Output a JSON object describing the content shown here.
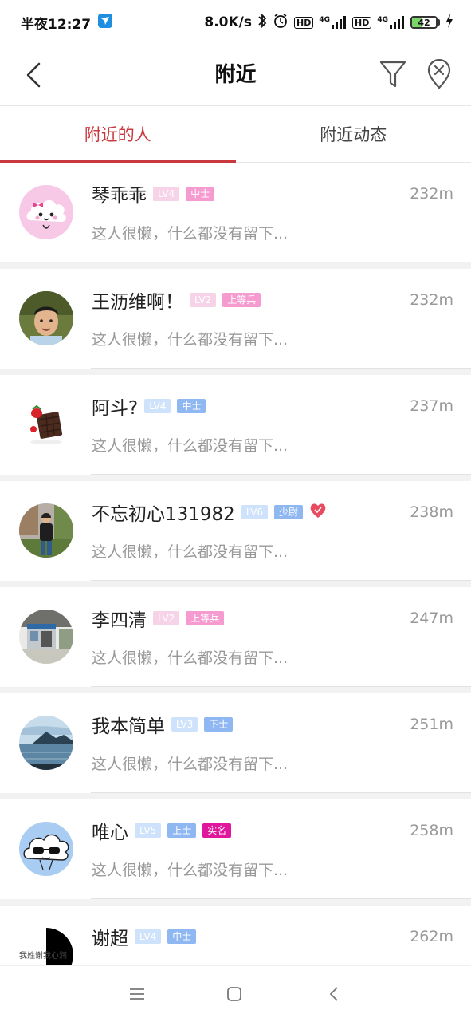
{
  "status_bar": {
    "time": "半夜12:27",
    "net_speed": "8.0K/s",
    "hd1": "HD",
    "hd2": "HD",
    "net1": "4G",
    "net2": "4G",
    "battery": "42",
    "battery_level": 0.42,
    "icons": [
      "app-notification-icon",
      "bluetooth-icon",
      "alarm-icon",
      "signal-icon",
      "battery-icon",
      "charging-icon"
    ]
  },
  "header": {
    "title": "附近",
    "icons": [
      "back-icon",
      "filter-icon",
      "location-clear-icon"
    ]
  },
  "tabs": [
    {
      "label": "附近的人",
      "active": true
    },
    {
      "label": "附近动态",
      "active": false
    }
  ],
  "colors": {
    "accent": "#c9383f",
    "lv_pink_bg": "#f7d3e8",
    "lv_pink_fg": "#ffffff",
    "rank_pink_bg": "#f59bd0",
    "lv_blue_bg": "#cfe2fb",
    "rank_blue_bg": "#8fb8f2",
    "verified_bg": "#e0169c"
  },
  "users": [
    {
      "name": "琴乖乖",
      "level": "LV4",
      "rank": "中士",
      "theme": "pink",
      "distance": "232m",
      "signature": "这人很懒，什么都没有留下...",
      "avatar": "cloud-cartoon-pink"
    },
    {
      "name": "王沥维啊！",
      "level": "LV2",
      "rank": "上等兵",
      "theme": "pink",
      "distance": "232m",
      "signature": "这人很懒，什么都没有留下...",
      "avatar": "child-photo"
    },
    {
      "name": "阿斗?",
      "level": "LV4",
      "rank": "中士",
      "theme": "blue",
      "distance": "237m",
      "signature": "这人很懒，什么都没有留下...",
      "avatar": "chocolate-photo"
    },
    {
      "name": "不忘初心131982",
      "level": "LV6",
      "rank": "少尉",
      "theme": "blue",
      "distance": "238m",
      "signature": "这人很懒，什么都没有留下...",
      "avatar": "man-outdoor-photo",
      "heart": true
    },
    {
      "name": "李四清",
      "level": "LV2",
      "rank": "上等兵",
      "theme": "pink",
      "distance": "247m",
      "signature": "这人很懒，什么都没有留下...",
      "avatar": "kiosk-photo"
    },
    {
      "name": "我本简单",
      "level": "LV3",
      "rank": "下士",
      "theme": "blue",
      "distance": "251m",
      "signature": "这人很懒，什么都没有留下...",
      "avatar": "lake-photo"
    },
    {
      "name": "唯心",
      "level": "LV5",
      "rank": "上士",
      "theme": "blue",
      "distance": "258m",
      "signature": "这人很懒，什么都没有留下...",
      "avatar": "cloud-sunglasses",
      "verified": "实名"
    },
    {
      "name": "谢超",
      "level": "LV4",
      "rank": "中士",
      "theme": "blue",
      "distance": "262m",
      "signature": "",
      "avatar": "text-avatar",
      "avatar_text": "我姓谢我心润"
    }
  ],
  "nav_bar": {
    "icons": [
      "menu-icon",
      "home-icon",
      "back-nav-icon"
    ]
  }
}
